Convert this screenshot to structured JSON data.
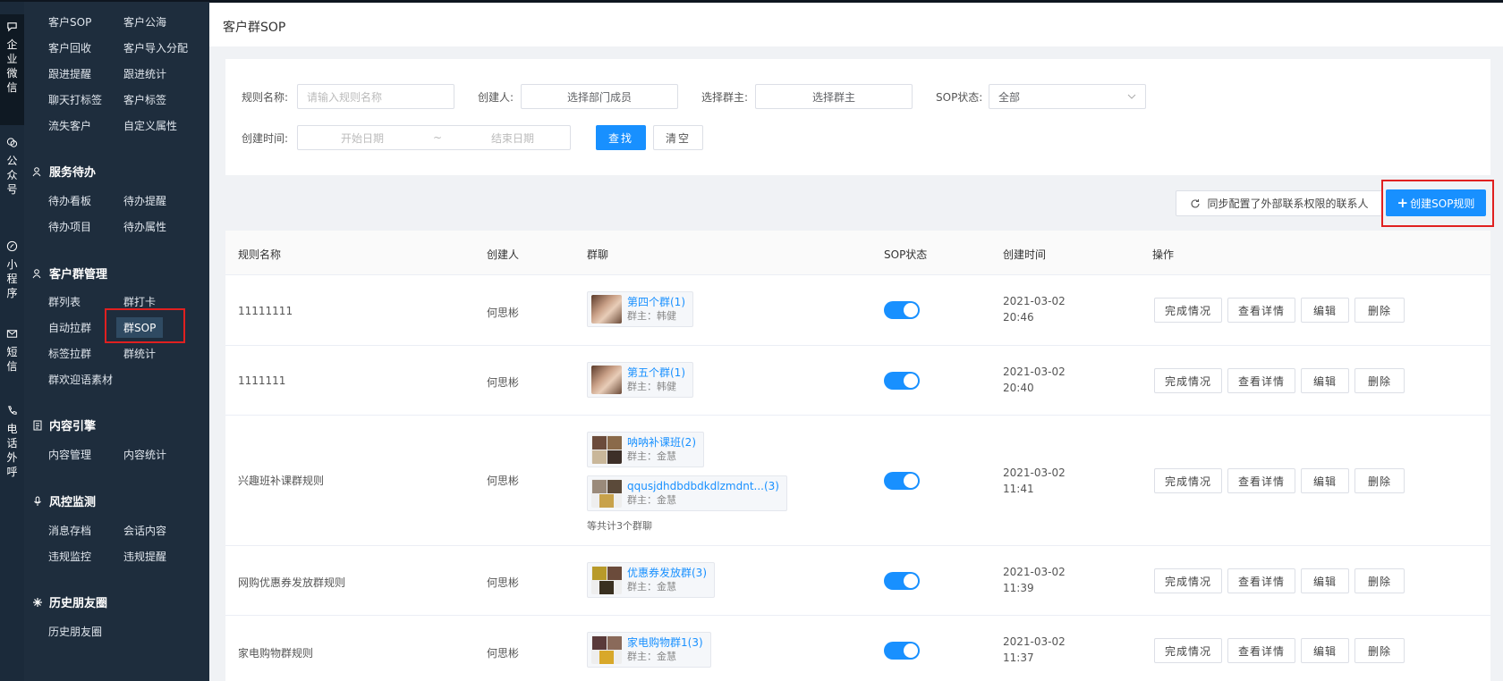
{
  "rail": {
    "items": [
      {
        "label": "企业微信",
        "icon": "chat-bubble-icon"
      },
      {
        "label": "公众号",
        "icon": "wechat-icon"
      },
      {
        "label": "小程序",
        "icon": "mini-program-icon"
      },
      {
        "label": "短信",
        "icon": "mail-icon"
      },
      {
        "label": "电话外呼",
        "icon": "phone-icon"
      }
    ]
  },
  "submenu": {
    "top_items": [
      [
        "客户SOP",
        "客户公海"
      ],
      [
        "客户回收",
        "客户导入分配"
      ],
      [
        "跟进提醒",
        "跟进统计"
      ],
      [
        "聊天打标签",
        "客户标签"
      ],
      [
        "流失客户",
        "自定义属性"
      ]
    ],
    "sections": [
      {
        "title": "服务待办",
        "items": [
          [
            "待办看板",
            "待办提醒"
          ],
          [
            "待办项目",
            "待办属性"
          ]
        ]
      },
      {
        "title": "客户群管理",
        "items": [
          [
            "群列表",
            "群打卡"
          ],
          [
            "自动拉群",
            "群SOP"
          ],
          [
            "标签拉群",
            "群统计"
          ],
          [
            "群欢迎语素材",
            ""
          ]
        ]
      },
      {
        "title": "内容引擎",
        "items": [
          [
            "内容管理",
            "内容统计"
          ]
        ]
      },
      {
        "title": "风控监测",
        "items": [
          [
            "消息存档",
            "会话内容"
          ],
          [
            "违规监控",
            "违规提醒"
          ]
        ]
      },
      {
        "title": "历史朋友圈",
        "items": [
          [
            "历史朋友圈",
            ""
          ]
        ]
      }
    ]
  },
  "page": {
    "title": "客户群SOP"
  },
  "filters": {
    "rule_name_label": "规则名称:",
    "rule_name_placeholder": "请输入规则名称",
    "creator_label": "创建人:",
    "creator_value": "选择部门成员",
    "owner_label": "选择群主:",
    "owner_value": "选择群主",
    "status_label": "SOP状态:",
    "status_value": "全部",
    "time_label": "创建时间:",
    "start_date": "开始日期",
    "range_sep": "~",
    "end_date": "结束日期",
    "search_btn": "查找",
    "clear_btn": "清空"
  },
  "actions": {
    "sync_label": "同步配置了外部联系权限的联系人",
    "create_label": "创建SOP规则",
    "create_plus": "+"
  },
  "table": {
    "headers": [
      "规则名称",
      "创建人",
      "群聊",
      "SOP状态",
      "创建时间",
      "操作"
    ],
    "op_labels": [
      "完成情况",
      "查看详情",
      "编辑",
      "删除"
    ],
    "rows": [
      {
        "name": "11111111",
        "creator": "何思彬",
        "groups": [
          {
            "name": "第四个群(1)",
            "owner": "群主：韩健"
          }
        ],
        "total": "",
        "enabled": true,
        "date": "2021-03-02",
        "time": "20:46"
      },
      {
        "name": "1111111",
        "creator": "何思彬",
        "groups": [
          {
            "name": "第五个群(1)",
            "owner": "群主：韩健"
          }
        ],
        "total": "",
        "enabled": true,
        "date": "2021-03-02",
        "time": "20:40"
      },
      {
        "name": "兴趣班补课群规则",
        "creator": "何思彬",
        "groups": [
          {
            "name": "呐呐补课班(2)",
            "owner": "群主：金慧"
          },
          {
            "name": "qqusjdhdbdbdkdlzmdnt...(3)",
            "owner": "群主：金慧"
          }
        ],
        "total": "等共计3个群聊",
        "enabled": true,
        "date": "2021-03-02",
        "time": "11:41"
      },
      {
        "name": "网购优惠券发放群规则",
        "creator": "何思彬",
        "groups": [
          {
            "name": "优惠券发放群(3)",
            "owner": "群主：金慧"
          }
        ],
        "total": "",
        "enabled": true,
        "date": "2021-03-02",
        "time": "11:39"
      },
      {
        "name": "家电购物群规则",
        "creator": "何思彬",
        "groups": [
          {
            "name": "家电购物群1(3)",
            "owner": "群主：金慧"
          }
        ],
        "total": "",
        "enabled": true,
        "date": "2021-03-02",
        "time": "11:37"
      }
    ]
  },
  "colors": {
    "primary": "#1890ff",
    "sidebar": "#1e2d3d",
    "highlight": "#e02020"
  }
}
